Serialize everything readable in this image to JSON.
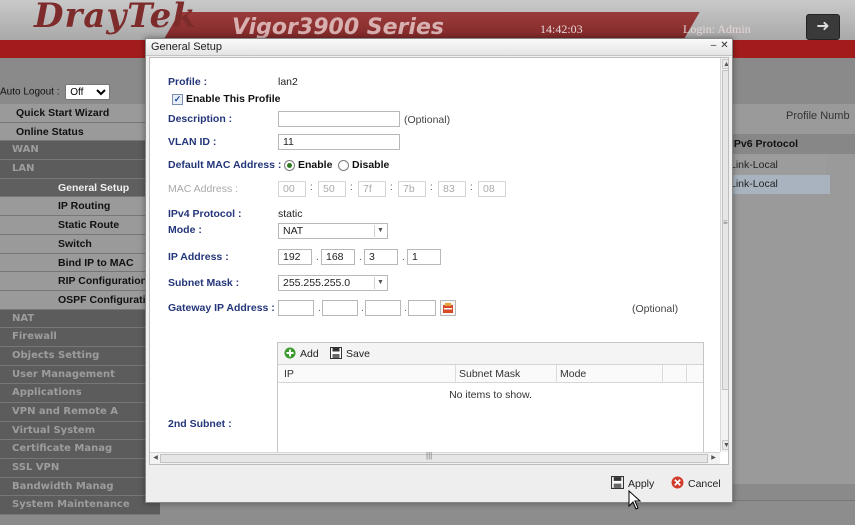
{
  "app": {
    "brand": "DrayTek",
    "series": "Vigor3900 Series",
    "time": "14:42:03",
    "login": "Login: Admin",
    "auto_logout_label": "Auto Logout :",
    "auto_logout_value": "Off"
  },
  "sidebar": {
    "items": [
      {
        "label": "Quick Start Wizard",
        "style": "light"
      },
      {
        "label": "Online Status",
        "style": "light"
      },
      {
        "label": "WAN",
        "style": "dark"
      },
      {
        "label": "LAN",
        "style": "dark"
      },
      {
        "label": "General Setup",
        "style": "sub-active"
      },
      {
        "label": "IP Routing",
        "style": "sub"
      },
      {
        "label": "Static Route",
        "style": "sub"
      },
      {
        "label": "Switch",
        "style": "sub"
      },
      {
        "label": "Bind IP to MAC",
        "style": "sub"
      },
      {
        "label": "RIP Configuration",
        "style": "sub"
      },
      {
        "label": "OSPF Configurati",
        "style": "sub"
      },
      {
        "label": "NAT",
        "style": "dark"
      },
      {
        "label": "Firewall",
        "style": "dark"
      },
      {
        "label": "Objects Setting",
        "style": "dark"
      },
      {
        "label": "User Management",
        "style": "dark"
      },
      {
        "label": "Applications",
        "style": "dark"
      },
      {
        "label": "VPN and Remote A",
        "style": "dark"
      },
      {
        "label": "Virtual System",
        "style": "dark"
      },
      {
        "label": "Certificate Manag",
        "style": "dark"
      },
      {
        "label": "SSL VPN",
        "style": "dark"
      },
      {
        "label": "Bandwidth Manag",
        "style": "dark"
      },
      {
        "label": "System Maintenance",
        "style": "dark"
      }
    ]
  },
  "background_table": {
    "profile_number_label": "Profile Numb",
    "column_header": "IPv6 Protocol",
    "rows": [
      "Link-Local",
      "Link-Local"
    ]
  },
  "dialog": {
    "title": "General Setup",
    "profile_label": "Profile :",
    "profile_value": "lan2",
    "enable_profile_label": "Enable This Profile",
    "enable_profile_checked": true,
    "description_label": "Description :",
    "description_value": "",
    "description_hint": "(Optional)",
    "vlan_label": "VLAN ID :",
    "vlan_value": "11",
    "default_mac_label": "Default MAC Address :",
    "enable_label": "Enable",
    "disable_label": "Disable",
    "default_mac_selected": "Enable",
    "mac_label": "MAC Address :",
    "mac_octets": [
      "00",
      "50",
      "7f",
      "7b",
      "83",
      "08"
    ],
    "ipv4_label": "IPv4 Protocol :",
    "ipv4_value": "static",
    "mode_label": "Mode :",
    "mode_value": "NAT",
    "ip_label": "IP Address :",
    "ip_octets": [
      "192",
      "168",
      "3",
      "1"
    ],
    "subnet_label": "Subnet Mask :",
    "subnet_value": "255.255.255.0",
    "gateway_label": "Gateway IP Address :",
    "gateway_octets": [
      "",
      "",
      "",
      ""
    ],
    "gateway_hint": "(Optional)",
    "second_subnet_label": "2nd Subnet :",
    "subnet_table": {
      "add_label": "Add",
      "save_label": "Save",
      "columns": [
        "IP",
        "Subnet Mask",
        "Mode"
      ],
      "empty_text": "No items to show."
    },
    "apply_label": "Apply",
    "cancel_label": "Cancel"
  },
  "colors": {
    "label_blue": "#24367a",
    "brand_red": "#a21c1c",
    "radio_green": "#2d7a1e"
  }
}
